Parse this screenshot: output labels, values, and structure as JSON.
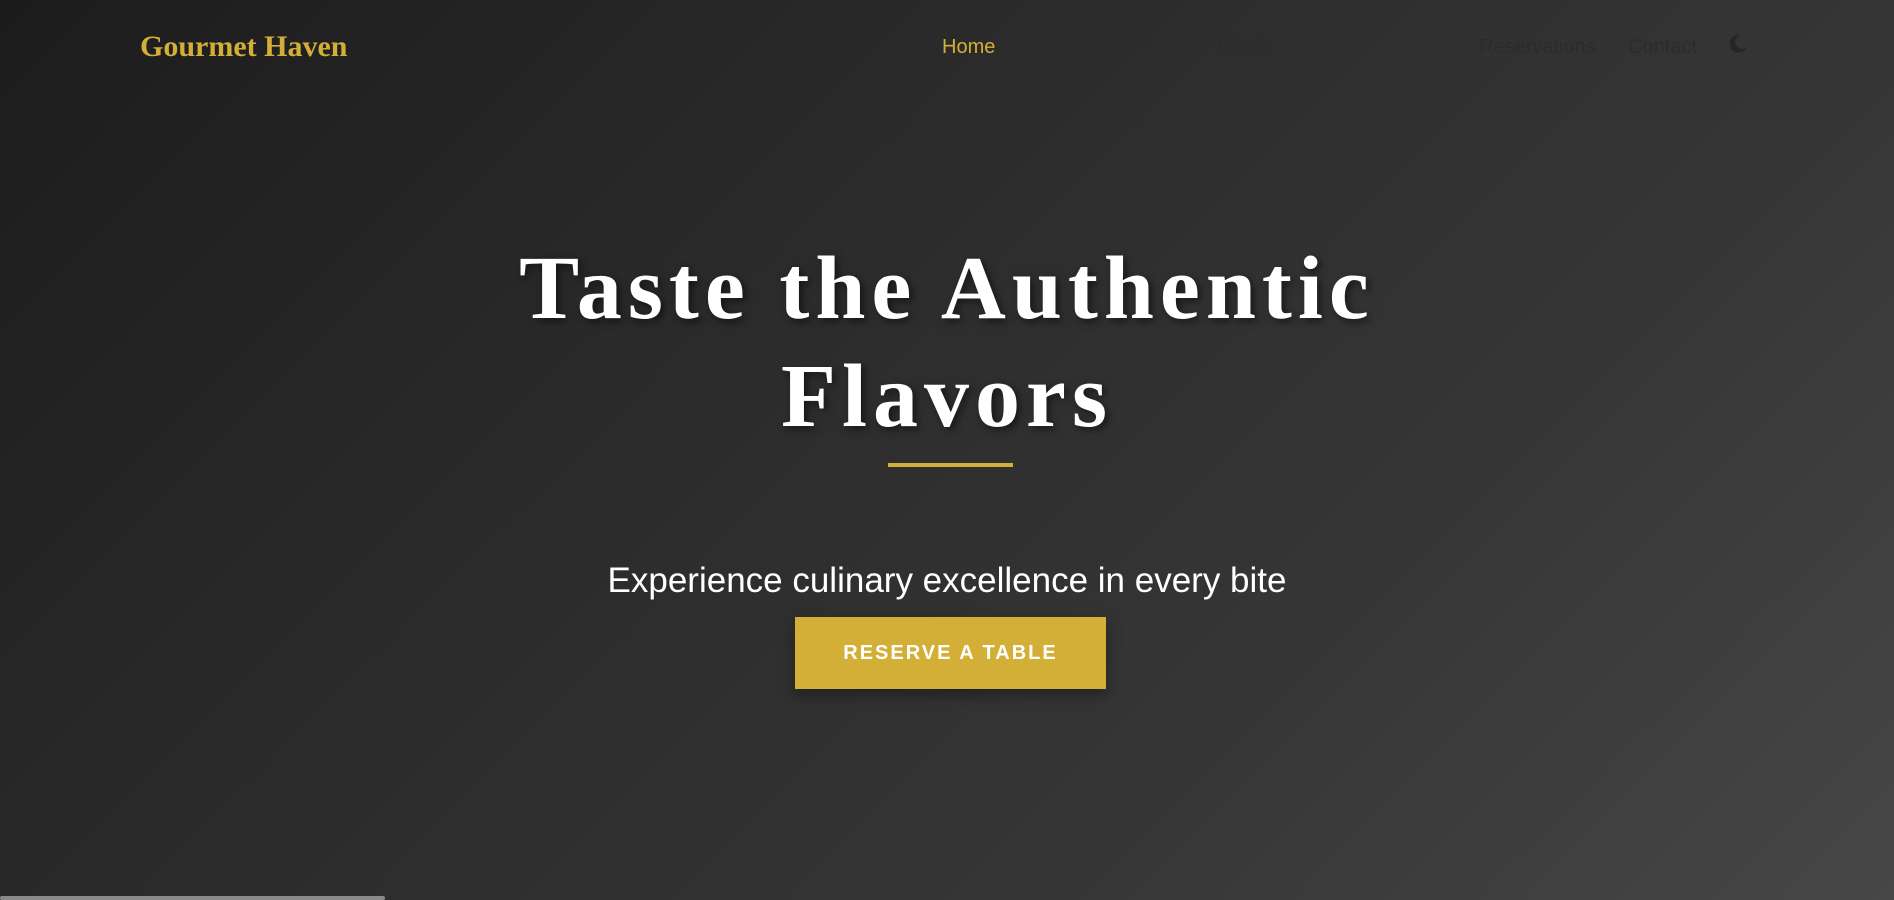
{
  "brand": {
    "name": "Gourmet Haven",
    "accent_color": "#d4af37"
  },
  "nav": {
    "items": [
      {
        "label": "Home",
        "active": true
      },
      {
        "label": "About",
        "active": false
      },
      {
        "label": "Menu",
        "active": false
      },
      {
        "label": "Chefs",
        "active": false
      },
      {
        "label": "Reservations",
        "active": false
      },
      {
        "label": "Contact",
        "active": false
      }
    ],
    "theme_toggle_icon": "moon-icon"
  },
  "hero": {
    "title_line1": "Taste the Authentic",
    "title_line2": "Flavors",
    "subtitle": "Experience culinary excellence in every bite",
    "cta_label": "RESERVE A TABLE"
  }
}
